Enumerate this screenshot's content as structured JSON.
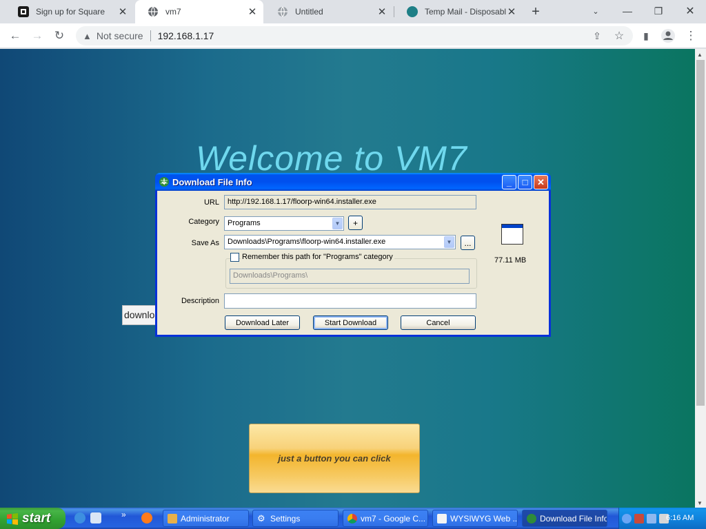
{
  "browser": {
    "tabs": [
      {
        "title": "Sign up for Square",
        "active": false
      },
      {
        "title": "vm7",
        "active": true
      },
      {
        "title": "Untitled",
        "active": false
      },
      {
        "title": "Temp Mail - Disposable Temporary",
        "active": false
      }
    ],
    "security_label": "Not secure",
    "address": "192.168.1.17"
  },
  "page": {
    "heading": "Welcome to VM7",
    "download_input_value": "download",
    "click_button_label": "just a button you can click"
  },
  "dialog": {
    "title": "Download File Info",
    "url_label": "URL",
    "url_value": "http://192.168.1.17/floorp-win64.installer.exe",
    "category_label": "Category",
    "category_value": "Programs",
    "add_category_label": "+",
    "save_as_label": "Save As",
    "save_as_value": "Downloads\\Programs\\floorp-win64.installer.exe",
    "browse_label": "...",
    "remember_label": "Remember this path for \"Programs\" category",
    "remember_path": "Downloads\\Programs\\",
    "description_label": "Description",
    "description_value": "",
    "file_size": "77.11  MB",
    "buttons": {
      "later": "Download Later",
      "start": "Start Download",
      "cancel": "Cancel"
    }
  },
  "taskbar": {
    "start_label": "start",
    "quicklaunch_more": "»",
    "items": [
      {
        "label": "Administrator"
      },
      {
        "label": "Settings"
      },
      {
        "label": "vm7 - Google C..."
      },
      {
        "label": "WYSIWYG Web ..."
      },
      {
        "label": "Download File Info"
      }
    ],
    "clock": "6:16 AM"
  },
  "colors": {
    "xp_title_blue": "#0053ee",
    "xp_dialog_bg": "#ece9d8",
    "welcome_text": "#6fd8ee",
    "button_gold": "#f3b52d"
  }
}
